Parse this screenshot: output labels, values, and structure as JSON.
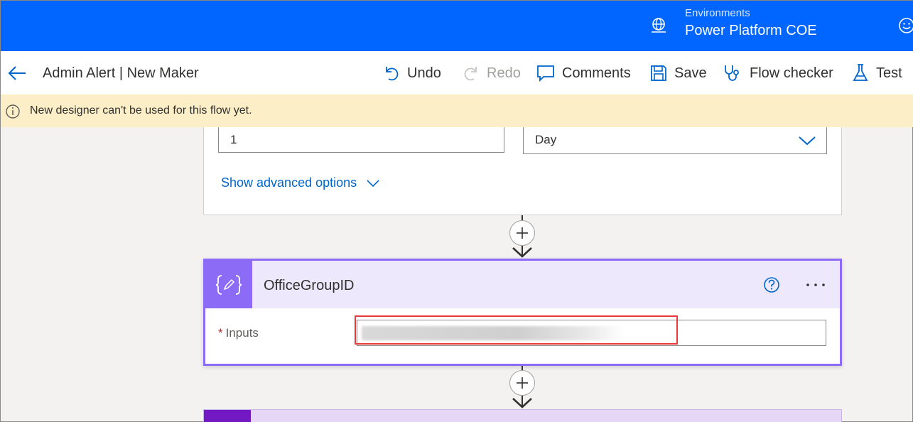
{
  "header": {
    "environment_label": "Environments",
    "environment_name": "Power Platform COE"
  },
  "command_bar": {
    "flow_title": "Admin Alert | New Maker",
    "undo": "Undo",
    "redo": "Redo",
    "comments": "Comments",
    "save": "Save",
    "flow_checker": "Flow checker",
    "test": "Test"
  },
  "banner": {
    "message": "New designer can't be used for this flow yet."
  },
  "recurrence": {
    "interval_value": "1",
    "frequency_value": "Day",
    "advanced_options_label": "Show advanced options"
  },
  "compose": {
    "title": "OfficeGroupID",
    "inputs_label": "Inputs",
    "required_marker": "*"
  },
  "colors": {
    "header_blue": "#0066ff",
    "banner_yellow": "#fcefc8",
    "compose_accent": "#8c6cf6",
    "highlight_red": "#e83a3a"
  }
}
